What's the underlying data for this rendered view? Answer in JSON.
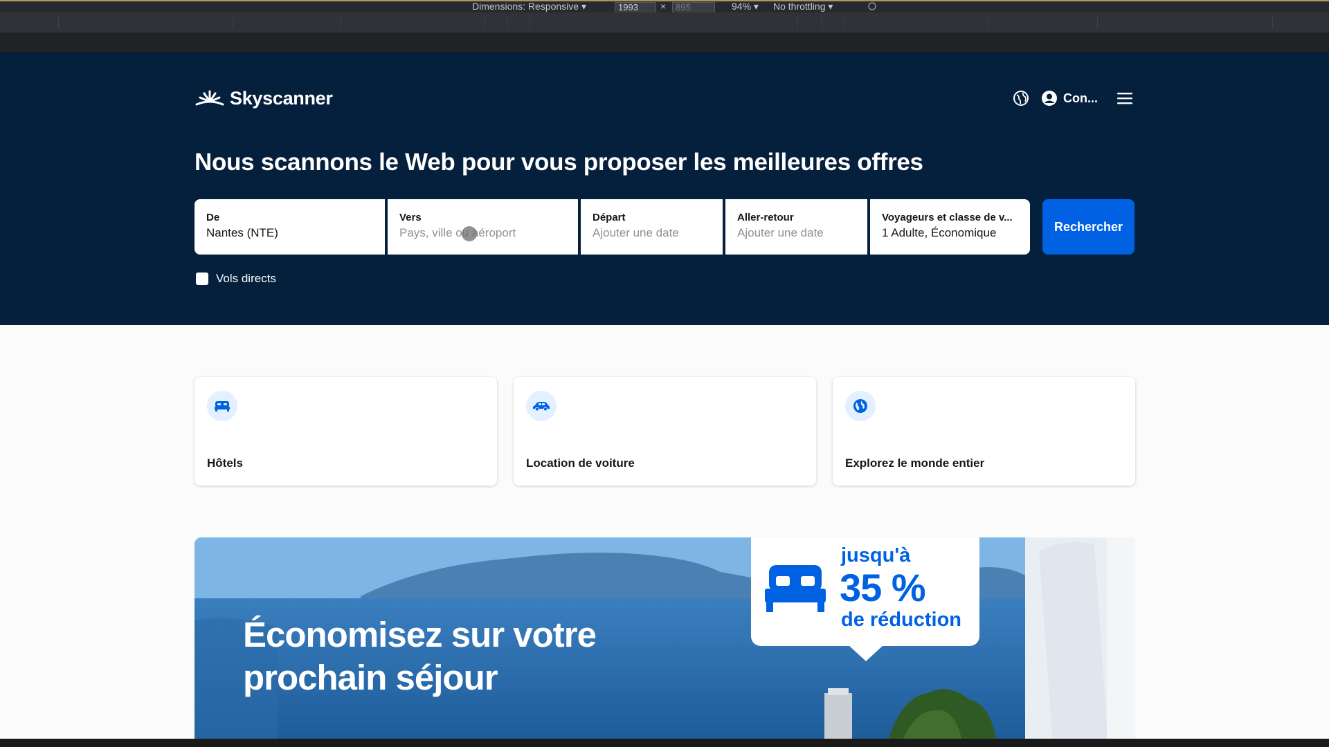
{
  "devtools": {
    "dimensions_label": "Dimensions: Responsive ▾",
    "width_value": "1993",
    "times_sign": "×",
    "height_value": "895",
    "zoom_label": "94% ▾",
    "throttle_label": "No throttling ▾"
  },
  "header": {
    "logo_text": "Skyscanner",
    "login_label": "Con..."
  },
  "hero": {
    "headline": "Nous scannons le Web pour vous proposer les meilleures offres"
  },
  "search": {
    "from_label": "De",
    "from_value": "Nantes (NTE)",
    "to_label": "Vers",
    "to_placeholder": "Pays, ville ou aéroport",
    "depart_label": "Départ",
    "depart_placeholder": "Ajouter une date",
    "return_label": "Aller-retour",
    "return_placeholder": "Ajouter une date",
    "travellers_label": "Voyageurs et classe de v...",
    "travellers_value": "1 Adulte, Économique",
    "search_button": "Rechercher",
    "direct_flights_label": "Vols directs"
  },
  "cards": [
    {
      "label": "Hôtels",
      "icon": "bed-icon"
    },
    {
      "label": "Location de voiture",
      "icon": "car-icon"
    },
    {
      "label": "Explorez le monde entier",
      "icon": "globe-icon"
    }
  ],
  "banner": {
    "title": "Économisez sur votre prochain séjour",
    "promo_prefix": "jusqu'à",
    "promo_percent": "35 %",
    "promo_suffix": "de réduction"
  },
  "colors": {
    "hero_bg": "#05203c",
    "primary": "#0062e3",
    "card_icon_bg": "#e3f0ff"
  }
}
